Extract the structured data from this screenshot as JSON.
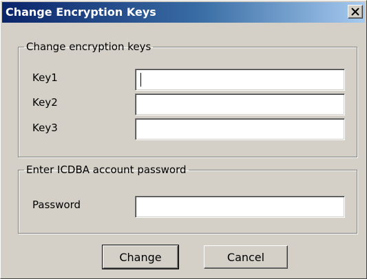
{
  "window": {
    "title": "Change Encryption Keys",
    "close_icon": "close-icon"
  },
  "keys_group": {
    "legend": "Change encryption keys",
    "key1_label": "Key1",
    "key1_value": "",
    "key2_label": "Key2",
    "key2_value": "",
    "key3_label": "Key3",
    "key3_value": ""
  },
  "password_group": {
    "legend": "Enter ICDBA account password",
    "password_label": "Password",
    "password_value": ""
  },
  "buttons": {
    "change_label": "Change",
    "cancel_label": "Cancel"
  },
  "colors": {
    "dialog_face": "#d4d0c8",
    "title_gradient_start": "#0a246a",
    "title_gradient_end": "#a6caf0",
    "title_text": "#ffffff"
  }
}
